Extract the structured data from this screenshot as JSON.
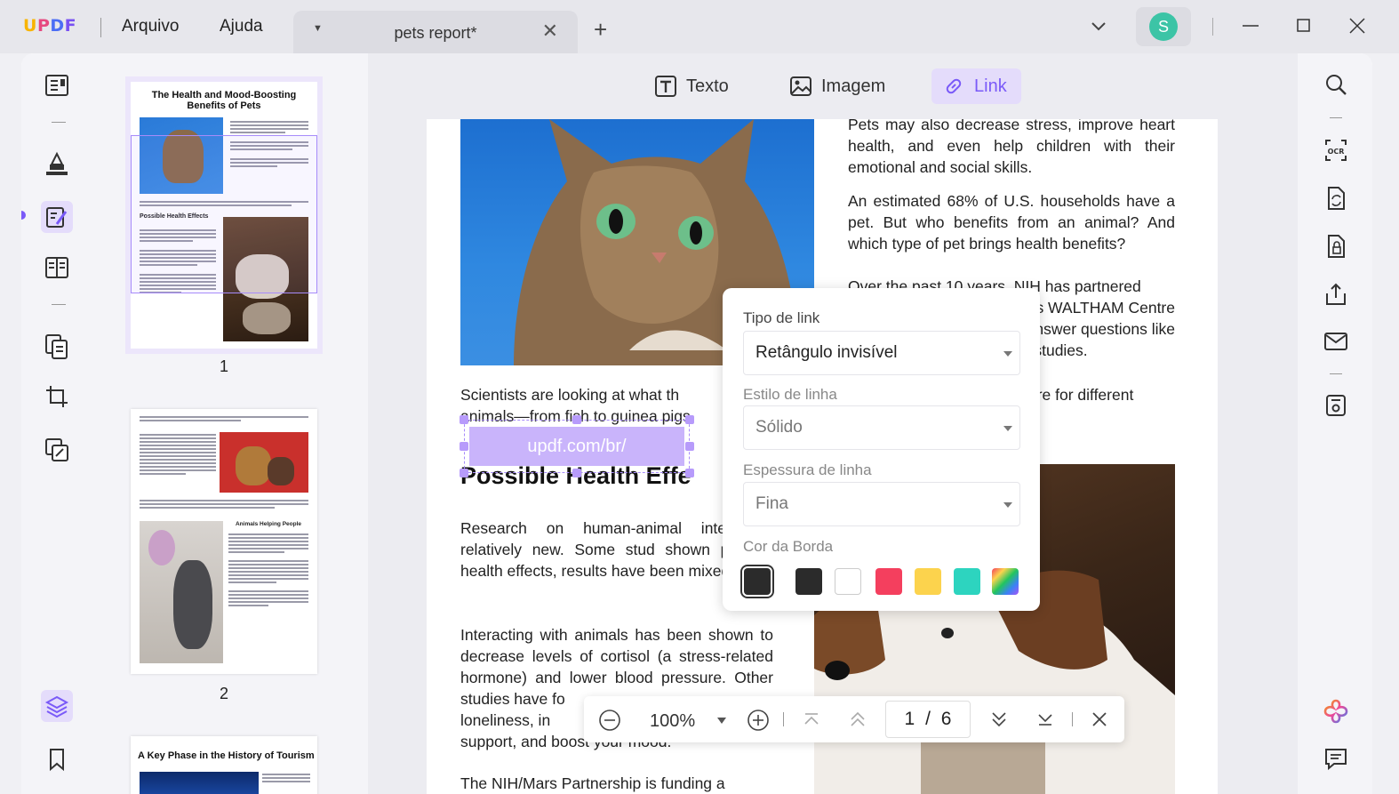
{
  "app": {
    "logo": "UPDF",
    "menus": [
      "Arquivo",
      "Ajuda"
    ]
  },
  "tab": {
    "title": "pets report*"
  },
  "user": {
    "avatar_letter": "S"
  },
  "toolbar": {
    "text": "Texto",
    "image": "Imagem",
    "link": "Link"
  },
  "thumbnails": {
    "page1": {
      "title": "The Health and Mood-Boosting Benefits of Pets",
      "subtitle": "Possible Health Effects",
      "num": "1"
    },
    "page2": {
      "subtitle": "Animals Helping People",
      "num": "2"
    },
    "page3": {
      "title": "A Key Phase in the History of Tourism"
    }
  },
  "document": {
    "para_top": "Pets may also decrease stress, improve heart health, and even help children with their emotional and social skills.",
    "para_households": "An estimated 68% of U.S. households have a pet. But who benefits from an animal? And which type of pet brings health benefits?",
    "para_nih_1": "Over the past 10 years, NIH has partnered",
    "para_nih_2": "on’s WALTHAM Centre",
    "para_nih_3": "nswer questions like",
    "para_nih_4": "ch studies.",
    "scientists_1": "Scientists are looking at what th",
    "scientists_2": "efits are for different",
    "scientists_3": "animals—from fish to guinea pigs",
    "link_text": "updf.com/br/",
    "heading": "Possible Health Effe",
    "research": "Research on human-animal inter still relatively new. Some stud shown positive health effects, results have been mixed.",
    "interacting": "Interacting with animals has been shown to decrease levels of cortisol (a stress-related hormone) and lower blood pressure. Other studies have fo",
    "loneliness": "loneliness, in",
    "support": "support, and boost your mood.",
    "nih_mars": "The NIH/Mars Partnership is funding a"
  },
  "link_popup": {
    "type_label": "Tipo de link",
    "type_value": "Retângulo invisível",
    "style_label": "Estilo de linha",
    "style_value": "Sólido",
    "width_label": "Espessura de linha",
    "width_value": "Fina",
    "color_label": "Cor da Borda",
    "colors": [
      "#2b2b2b",
      "#2b2b2b",
      "#ffffff",
      "#f43f5e",
      "#fcd34d",
      "#2dd4bf",
      "rainbow"
    ]
  },
  "page_nav": {
    "zoom": "100%",
    "current": "1",
    "sep": "/",
    "total": "6"
  }
}
